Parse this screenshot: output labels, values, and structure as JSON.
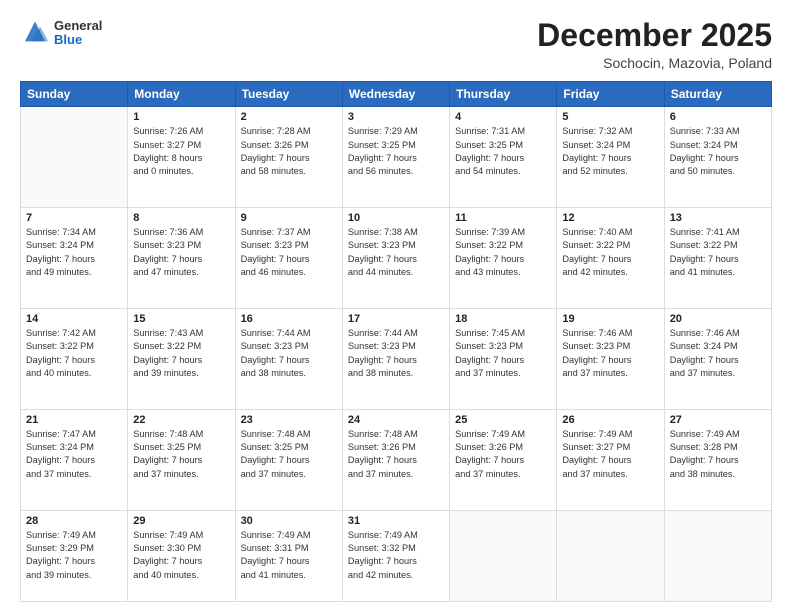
{
  "header": {
    "logo": {
      "general": "General",
      "blue": "Blue"
    },
    "title": "December 2025",
    "location": "Sochocin, Mazovia, Poland"
  },
  "days_of_week": [
    "Sunday",
    "Monday",
    "Tuesday",
    "Wednesday",
    "Thursday",
    "Friday",
    "Saturday"
  ],
  "weeks": [
    [
      {
        "day": "",
        "empty": true
      },
      {
        "day": "1",
        "sunrise": "Sunrise: 7:26 AM",
        "sunset": "Sunset: 3:27 PM",
        "daylight": "Daylight: 8 hours and 0 minutes."
      },
      {
        "day": "2",
        "sunrise": "Sunrise: 7:28 AM",
        "sunset": "Sunset: 3:26 PM",
        "daylight": "Daylight: 7 hours and 58 minutes."
      },
      {
        "day": "3",
        "sunrise": "Sunrise: 7:29 AM",
        "sunset": "Sunset: 3:25 PM",
        "daylight": "Daylight: 7 hours and 56 minutes."
      },
      {
        "day": "4",
        "sunrise": "Sunrise: 7:31 AM",
        "sunset": "Sunset: 3:25 PM",
        "daylight": "Daylight: 7 hours and 54 minutes."
      },
      {
        "day": "5",
        "sunrise": "Sunrise: 7:32 AM",
        "sunset": "Sunset: 3:24 PM",
        "daylight": "Daylight: 7 hours and 52 minutes."
      },
      {
        "day": "6",
        "sunrise": "Sunrise: 7:33 AM",
        "sunset": "Sunset: 3:24 PM",
        "daylight": "Daylight: 7 hours and 50 minutes."
      }
    ],
    [
      {
        "day": "7",
        "sunrise": "Sunrise: 7:34 AM",
        "sunset": "Sunset: 3:24 PM",
        "daylight": "Daylight: 7 hours and 49 minutes."
      },
      {
        "day": "8",
        "sunrise": "Sunrise: 7:36 AM",
        "sunset": "Sunset: 3:23 PM",
        "daylight": "Daylight: 7 hours and 47 minutes."
      },
      {
        "day": "9",
        "sunrise": "Sunrise: 7:37 AM",
        "sunset": "Sunset: 3:23 PM",
        "daylight": "Daylight: 7 hours and 46 minutes."
      },
      {
        "day": "10",
        "sunrise": "Sunrise: 7:38 AM",
        "sunset": "Sunset: 3:23 PM",
        "daylight": "Daylight: 7 hours and 44 minutes."
      },
      {
        "day": "11",
        "sunrise": "Sunrise: 7:39 AM",
        "sunset": "Sunset: 3:22 PM",
        "daylight": "Daylight: 7 hours and 43 minutes."
      },
      {
        "day": "12",
        "sunrise": "Sunrise: 7:40 AM",
        "sunset": "Sunset: 3:22 PM",
        "daylight": "Daylight: 7 hours and 42 minutes."
      },
      {
        "day": "13",
        "sunrise": "Sunrise: 7:41 AM",
        "sunset": "Sunset: 3:22 PM",
        "daylight": "Daylight: 7 hours and 41 minutes."
      }
    ],
    [
      {
        "day": "14",
        "sunrise": "Sunrise: 7:42 AM",
        "sunset": "Sunset: 3:22 PM",
        "daylight": "Daylight: 7 hours and 40 minutes."
      },
      {
        "day": "15",
        "sunrise": "Sunrise: 7:43 AM",
        "sunset": "Sunset: 3:22 PM",
        "daylight": "Daylight: 7 hours and 39 minutes."
      },
      {
        "day": "16",
        "sunrise": "Sunrise: 7:44 AM",
        "sunset": "Sunset: 3:23 PM",
        "daylight": "Daylight: 7 hours and 38 minutes."
      },
      {
        "day": "17",
        "sunrise": "Sunrise: 7:44 AM",
        "sunset": "Sunset: 3:23 PM",
        "daylight": "Daylight: 7 hours and 38 minutes."
      },
      {
        "day": "18",
        "sunrise": "Sunrise: 7:45 AM",
        "sunset": "Sunset: 3:23 PM",
        "daylight": "Daylight: 7 hours and 37 minutes."
      },
      {
        "day": "19",
        "sunrise": "Sunrise: 7:46 AM",
        "sunset": "Sunset: 3:23 PM",
        "daylight": "Daylight: 7 hours and 37 minutes."
      },
      {
        "day": "20",
        "sunrise": "Sunrise: 7:46 AM",
        "sunset": "Sunset: 3:24 PM",
        "daylight": "Daylight: 7 hours and 37 minutes."
      }
    ],
    [
      {
        "day": "21",
        "sunrise": "Sunrise: 7:47 AM",
        "sunset": "Sunset: 3:24 PM",
        "daylight": "Daylight: 7 hours and 37 minutes."
      },
      {
        "day": "22",
        "sunrise": "Sunrise: 7:48 AM",
        "sunset": "Sunset: 3:25 PM",
        "daylight": "Daylight: 7 hours and 37 minutes."
      },
      {
        "day": "23",
        "sunrise": "Sunrise: 7:48 AM",
        "sunset": "Sunset: 3:25 PM",
        "daylight": "Daylight: 7 hours and 37 minutes."
      },
      {
        "day": "24",
        "sunrise": "Sunrise: 7:48 AM",
        "sunset": "Sunset: 3:26 PM",
        "daylight": "Daylight: 7 hours and 37 minutes."
      },
      {
        "day": "25",
        "sunrise": "Sunrise: 7:49 AM",
        "sunset": "Sunset: 3:26 PM",
        "daylight": "Daylight: 7 hours and 37 minutes."
      },
      {
        "day": "26",
        "sunrise": "Sunrise: 7:49 AM",
        "sunset": "Sunset: 3:27 PM",
        "daylight": "Daylight: 7 hours and 37 minutes."
      },
      {
        "day": "27",
        "sunrise": "Sunrise: 7:49 AM",
        "sunset": "Sunset: 3:28 PM",
        "daylight": "Daylight: 7 hours and 38 minutes."
      }
    ],
    [
      {
        "day": "28",
        "sunrise": "Sunrise: 7:49 AM",
        "sunset": "Sunset: 3:29 PM",
        "daylight": "Daylight: 7 hours and 39 minutes."
      },
      {
        "day": "29",
        "sunrise": "Sunrise: 7:49 AM",
        "sunset": "Sunset: 3:30 PM",
        "daylight": "Daylight: 7 hours and 40 minutes."
      },
      {
        "day": "30",
        "sunrise": "Sunrise: 7:49 AM",
        "sunset": "Sunset: 3:31 PM",
        "daylight": "Daylight: 7 hours and 41 minutes."
      },
      {
        "day": "31",
        "sunrise": "Sunrise: 7:49 AM",
        "sunset": "Sunset: 3:32 PM",
        "daylight": "Daylight: 7 hours and 42 minutes."
      },
      {
        "day": "",
        "empty": true
      },
      {
        "day": "",
        "empty": true
      },
      {
        "day": "",
        "empty": true
      }
    ]
  ]
}
